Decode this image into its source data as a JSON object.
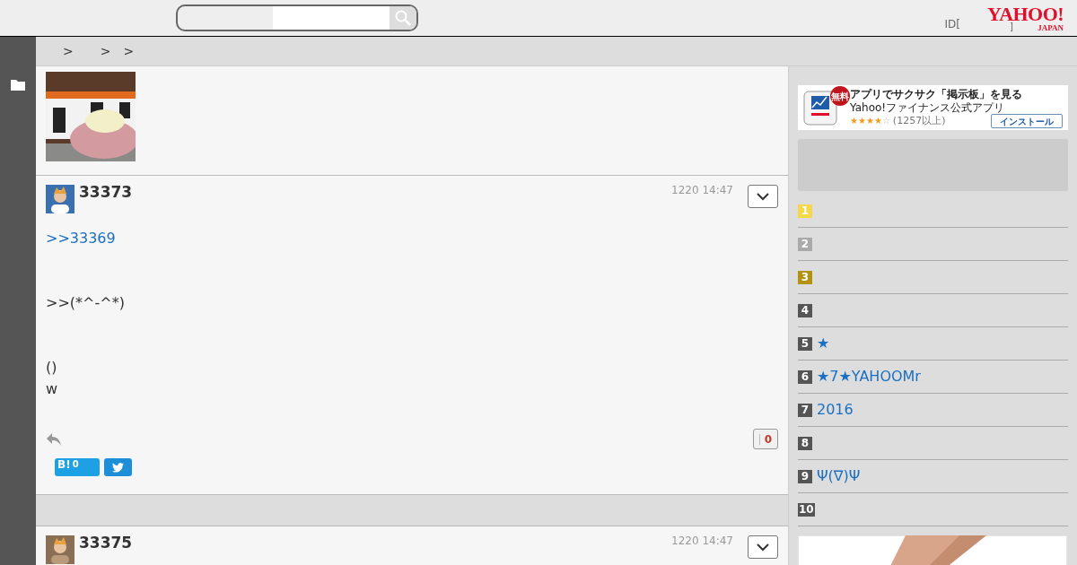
{
  "header": {
    "login": {
      "open": "ID[",
      "close": "]"
    },
    "logo": {
      "main": "YAHOO!",
      "sub": "JAPAN"
    }
  },
  "breadcrumb": [
    ">",
    ">",
    ">"
  ],
  "posts": [
    {
      "number": "33373",
      "time": "1220 14:47",
      "paragraphs": [
        [
          {
            "kind": "link",
            "text": ">>33369"
          }
        ],
        [
          {
            "kind": "text",
            "text": ">>(*^-^*)"
          }
        ],
        [
          {
            "kind": "text",
            "text": "()"
          },
          {
            "kind": "text",
            "text": "w"
          }
        ]
      ],
      "likes": "0",
      "hatena": {
        "mark": "B!",
        "count": "0"
      }
    },
    {
      "number": "33375",
      "time": "1220 14:47"
    }
  ],
  "ad": {
    "badge": "無料",
    "title": "アプリでサクサク「掲示板」を見る",
    "subtitle": "Yahoo!ファイナンス公式アプリ",
    "stars": 4,
    "reviews": "(1257以上)",
    "button": "インストール"
  },
  "ranking": [
    {
      "rank": "1",
      "color": "#f5d84a"
    },
    {
      "rank": "2",
      "color": "#aaaaaa"
    },
    {
      "rank": "3",
      "color": "#b39210"
    },
    {
      "rank": "4",
      "color": "#555555"
    },
    {
      "rank": "5",
      "color": "#555555",
      "title": "★"
    },
    {
      "rank": "6",
      "color": "#555555",
      "title": "★7★YAHOOMr"
    },
    {
      "rank": "7",
      "color": "#555555",
      "title": "2016"
    },
    {
      "rank": "8",
      "color": "#555555"
    },
    {
      "rank": "9",
      "color": "#555555",
      "title": "Ψ(∇)Ψ"
    },
    {
      "rank": "10",
      "color": "#555555"
    }
  ]
}
